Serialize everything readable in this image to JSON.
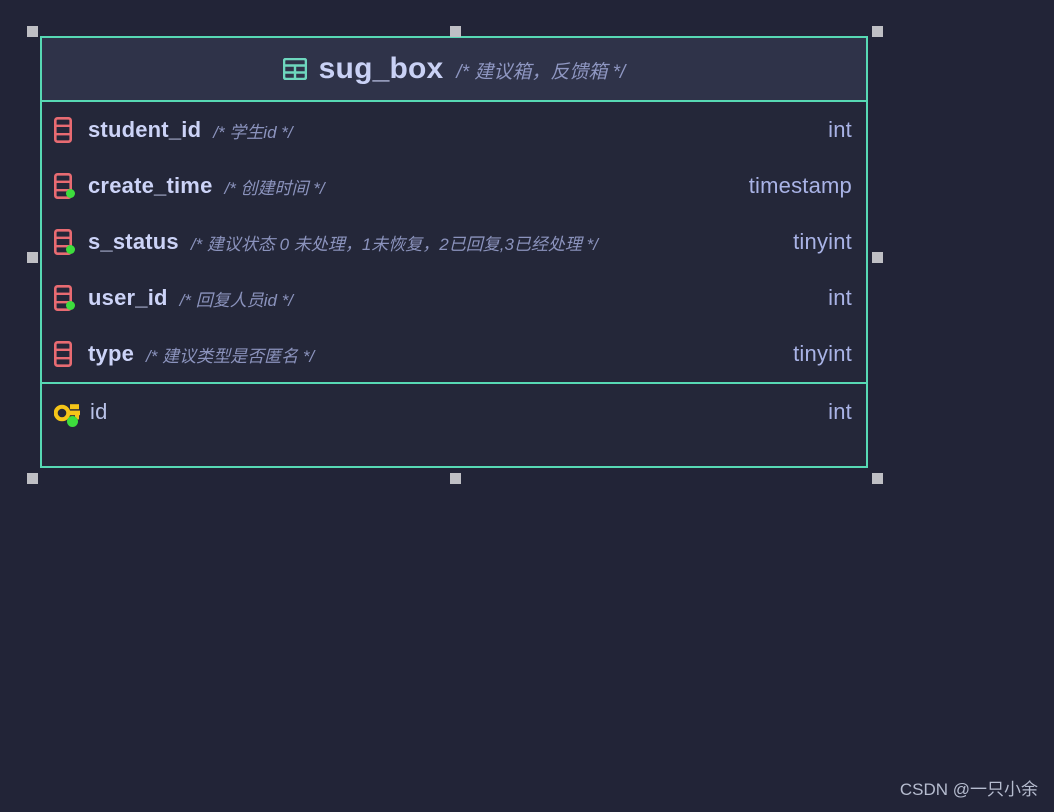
{
  "canvas": {
    "background_color": "#222437",
    "accent_color": "#57d9b4"
  },
  "table": {
    "icon": "table-grid-icon",
    "name": "sug_box",
    "comment": "/* 建议箱，反馈箱 */",
    "header_background": "#2f3349",
    "body_background": "#242739",
    "columns": [
      {
        "icon": "column-icon",
        "name": "student_id",
        "comment": "/* 学生id */",
        "type": "int",
        "nullable": false
      },
      {
        "icon": "column-icon",
        "name": "create_time",
        "comment": "/* 创建时间 */",
        "type": "timestamp",
        "nullable": true
      },
      {
        "icon": "column-icon",
        "name": "s_status",
        "comment": "/* 建议状态 0 未处理，1未恢复，2已回复,3已经处理 */",
        "type": "tinyint",
        "nullable": true
      },
      {
        "icon": "column-icon",
        "name": "user_id",
        "comment": "/* 回复人员id */",
        "type": "int",
        "nullable": true
      },
      {
        "icon": "column-icon",
        "name": "type",
        "comment": "/* 建议类型是否匿名 */",
        "type": "tinyint",
        "nullable": false
      }
    ],
    "primary_key": {
      "icon": "primary-key-icon",
      "name": "id",
      "type": "int",
      "nullable": true
    }
  },
  "selection": {
    "handle_color": "#bfbfc4",
    "handle_count": 8
  },
  "watermark": {
    "text": "CSDN @一只小余"
  }
}
